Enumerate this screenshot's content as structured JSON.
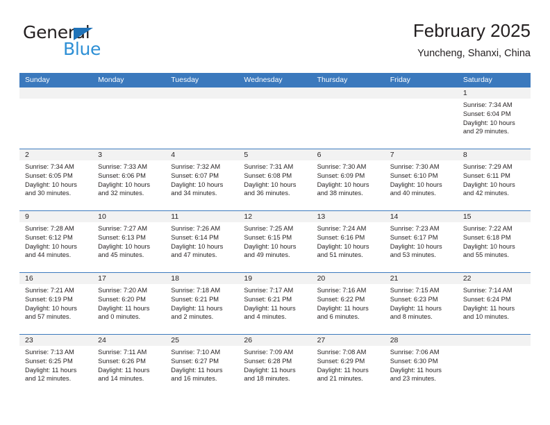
{
  "brand": {
    "name_part1": "General",
    "name_part2": "Blue",
    "triangle_color": "#1f72b8",
    "blue_color": "#2d8fd5"
  },
  "header": {
    "title": "February 2025",
    "location": "Yuncheng, Shanxi, China"
  },
  "theme": {
    "header_blue": "#3b79bd",
    "day_band_gray": "#f2f2f2",
    "text": "#231f20"
  },
  "weekdays": [
    "Sunday",
    "Monday",
    "Tuesday",
    "Wednesday",
    "Thursday",
    "Friday",
    "Saturday"
  ],
  "weeks": [
    [
      {
        "day": "",
        "sunrise": "",
        "sunset": "",
        "daylight": "",
        "daylight2": ""
      },
      {
        "day": "",
        "sunrise": "",
        "sunset": "",
        "daylight": "",
        "daylight2": ""
      },
      {
        "day": "",
        "sunrise": "",
        "sunset": "",
        "daylight": "",
        "daylight2": ""
      },
      {
        "day": "",
        "sunrise": "",
        "sunset": "",
        "daylight": "",
        "daylight2": ""
      },
      {
        "day": "",
        "sunrise": "",
        "sunset": "",
        "daylight": "",
        "daylight2": ""
      },
      {
        "day": "",
        "sunrise": "",
        "sunset": "",
        "daylight": "",
        "daylight2": ""
      },
      {
        "day": "1",
        "sunrise": "Sunrise: 7:34 AM",
        "sunset": "Sunset: 6:04 PM",
        "daylight": "Daylight: 10 hours",
        "daylight2": "and 29 minutes."
      }
    ],
    [
      {
        "day": "2",
        "sunrise": "Sunrise: 7:34 AM",
        "sunset": "Sunset: 6:05 PM",
        "daylight": "Daylight: 10 hours",
        "daylight2": "and 30 minutes."
      },
      {
        "day": "3",
        "sunrise": "Sunrise: 7:33 AM",
        "sunset": "Sunset: 6:06 PM",
        "daylight": "Daylight: 10 hours",
        "daylight2": "and 32 minutes."
      },
      {
        "day": "4",
        "sunrise": "Sunrise: 7:32 AM",
        "sunset": "Sunset: 6:07 PM",
        "daylight": "Daylight: 10 hours",
        "daylight2": "and 34 minutes."
      },
      {
        "day": "5",
        "sunrise": "Sunrise: 7:31 AM",
        "sunset": "Sunset: 6:08 PM",
        "daylight": "Daylight: 10 hours",
        "daylight2": "and 36 minutes."
      },
      {
        "day": "6",
        "sunrise": "Sunrise: 7:30 AM",
        "sunset": "Sunset: 6:09 PM",
        "daylight": "Daylight: 10 hours",
        "daylight2": "and 38 minutes."
      },
      {
        "day": "7",
        "sunrise": "Sunrise: 7:30 AM",
        "sunset": "Sunset: 6:10 PM",
        "daylight": "Daylight: 10 hours",
        "daylight2": "and 40 minutes."
      },
      {
        "day": "8",
        "sunrise": "Sunrise: 7:29 AM",
        "sunset": "Sunset: 6:11 PM",
        "daylight": "Daylight: 10 hours",
        "daylight2": "and 42 minutes."
      }
    ],
    [
      {
        "day": "9",
        "sunrise": "Sunrise: 7:28 AM",
        "sunset": "Sunset: 6:12 PM",
        "daylight": "Daylight: 10 hours",
        "daylight2": "and 44 minutes."
      },
      {
        "day": "10",
        "sunrise": "Sunrise: 7:27 AM",
        "sunset": "Sunset: 6:13 PM",
        "daylight": "Daylight: 10 hours",
        "daylight2": "and 45 minutes."
      },
      {
        "day": "11",
        "sunrise": "Sunrise: 7:26 AM",
        "sunset": "Sunset: 6:14 PM",
        "daylight": "Daylight: 10 hours",
        "daylight2": "and 47 minutes."
      },
      {
        "day": "12",
        "sunrise": "Sunrise: 7:25 AM",
        "sunset": "Sunset: 6:15 PM",
        "daylight": "Daylight: 10 hours",
        "daylight2": "and 49 minutes."
      },
      {
        "day": "13",
        "sunrise": "Sunrise: 7:24 AM",
        "sunset": "Sunset: 6:16 PM",
        "daylight": "Daylight: 10 hours",
        "daylight2": "and 51 minutes."
      },
      {
        "day": "14",
        "sunrise": "Sunrise: 7:23 AM",
        "sunset": "Sunset: 6:17 PM",
        "daylight": "Daylight: 10 hours",
        "daylight2": "and 53 minutes."
      },
      {
        "day": "15",
        "sunrise": "Sunrise: 7:22 AM",
        "sunset": "Sunset: 6:18 PM",
        "daylight": "Daylight: 10 hours",
        "daylight2": "and 55 minutes."
      }
    ],
    [
      {
        "day": "16",
        "sunrise": "Sunrise: 7:21 AM",
        "sunset": "Sunset: 6:19 PM",
        "daylight": "Daylight: 10 hours",
        "daylight2": "and 57 minutes."
      },
      {
        "day": "17",
        "sunrise": "Sunrise: 7:20 AM",
        "sunset": "Sunset: 6:20 PM",
        "daylight": "Daylight: 11 hours",
        "daylight2": "and 0 minutes."
      },
      {
        "day": "18",
        "sunrise": "Sunrise: 7:18 AM",
        "sunset": "Sunset: 6:21 PM",
        "daylight": "Daylight: 11 hours",
        "daylight2": "and 2 minutes."
      },
      {
        "day": "19",
        "sunrise": "Sunrise: 7:17 AM",
        "sunset": "Sunset: 6:21 PM",
        "daylight": "Daylight: 11 hours",
        "daylight2": "and 4 minutes."
      },
      {
        "day": "20",
        "sunrise": "Sunrise: 7:16 AM",
        "sunset": "Sunset: 6:22 PM",
        "daylight": "Daylight: 11 hours",
        "daylight2": "and 6 minutes."
      },
      {
        "day": "21",
        "sunrise": "Sunrise: 7:15 AM",
        "sunset": "Sunset: 6:23 PM",
        "daylight": "Daylight: 11 hours",
        "daylight2": "and 8 minutes."
      },
      {
        "day": "22",
        "sunrise": "Sunrise: 7:14 AM",
        "sunset": "Sunset: 6:24 PM",
        "daylight": "Daylight: 11 hours",
        "daylight2": "and 10 minutes."
      }
    ],
    [
      {
        "day": "23",
        "sunrise": "Sunrise: 7:13 AM",
        "sunset": "Sunset: 6:25 PM",
        "daylight": "Daylight: 11 hours",
        "daylight2": "and 12 minutes."
      },
      {
        "day": "24",
        "sunrise": "Sunrise: 7:11 AM",
        "sunset": "Sunset: 6:26 PM",
        "daylight": "Daylight: 11 hours",
        "daylight2": "and 14 minutes."
      },
      {
        "day": "25",
        "sunrise": "Sunrise: 7:10 AM",
        "sunset": "Sunset: 6:27 PM",
        "daylight": "Daylight: 11 hours",
        "daylight2": "and 16 minutes."
      },
      {
        "day": "26",
        "sunrise": "Sunrise: 7:09 AM",
        "sunset": "Sunset: 6:28 PM",
        "daylight": "Daylight: 11 hours",
        "daylight2": "and 18 minutes."
      },
      {
        "day": "27",
        "sunrise": "Sunrise: 7:08 AM",
        "sunset": "Sunset: 6:29 PM",
        "daylight": "Daylight: 11 hours",
        "daylight2": "and 21 minutes."
      },
      {
        "day": "28",
        "sunrise": "Sunrise: 7:06 AM",
        "sunset": "Sunset: 6:30 PM",
        "daylight": "Daylight: 11 hours",
        "daylight2": "and 23 minutes."
      },
      {
        "day": "",
        "sunrise": "",
        "sunset": "",
        "daylight": "",
        "daylight2": ""
      }
    ]
  ]
}
